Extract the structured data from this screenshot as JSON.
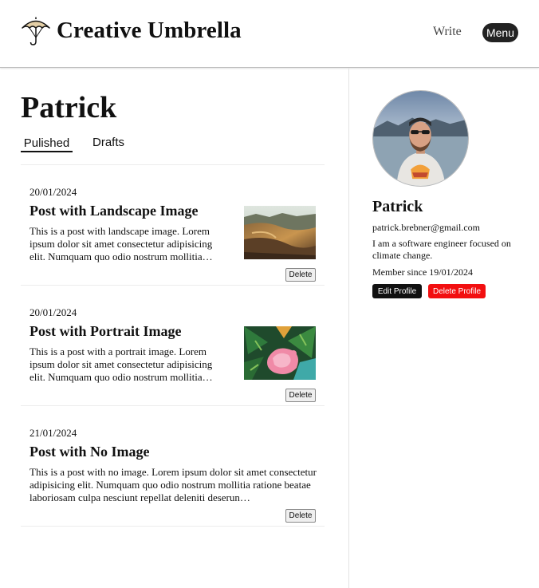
{
  "header": {
    "brand": "Creative Umbrella",
    "logo_icon": "umbrella-icon",
    "write_label": "Write",
    "menu_label": "Menu"
  },
  "profile_page": {
    "title": "Patrick",
    "tabs": [
      {
        "label": "Pulished",
        "active": true
      },
      {
        "label": "Drafts",
        "active": false
      }
    ]
  },
  "posts": [
    {
      "date": "20/01/2024",
      "title": "Post with Landscape Image",
      "excerpt": "This is a post with landscape image. Lorem ipsum dolor sit amet consectetur adipisicing elit. Numquam quo odio nostrum mollitia…",
      "has_image": true,
      "delete_label": "Delete"
    },
    {
      "date": "20/01/2024",
      "title": "Post with Portrait Image",
      "excerpt": "This is a post with a portrait image. Lorem ipsum dolor sit amet consectetur adipisicing elit. Numquam quo odio nostrum mollitia…",
      "has_image": true,
      "delete_label": "Delete"
    },
    {
      "date": "21/01/2024",
      "title": "Post with No Image",
      "excerpt": "This is a post with no image. Lorem ipsum dolor sit amet consectetur adipisicing elit. Numquam quo odio nostrum mollitia ratione beatae laboriosam culpa nesciunt repellat deleniti deserun…",
      "has_image": false,
      "delete_label": "Delete"
    }
  ],
  "sidebar": {
    "name": "Patrick",
    "email": "patrick.brebner@gmail.com",
    "bio": "I am a software engineer focused on climate change.",
    "member_since": "Member since 19/01/2024",
    "edit_label": "Edit Profile",
    "delete_label": "Delete Profile"
  },
  "colors": {
    "menu_bg": "#222222",
    "delete_profile_bg": "#f20f10",
    "edit_profile_bg": "#111111"
  }
}
